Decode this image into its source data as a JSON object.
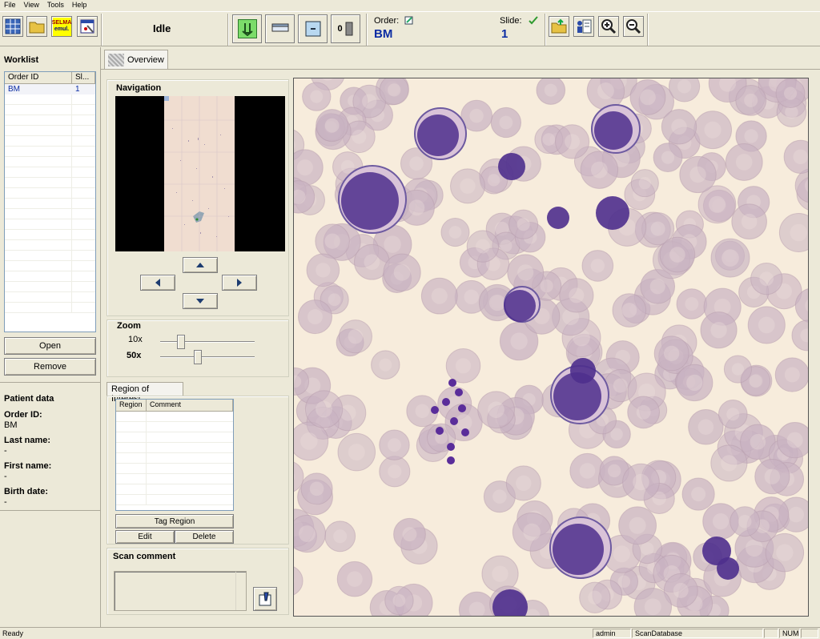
{
  "menu": [
    "File",
    "View",
    "Tools",
    "Help"
  ],
  "toolbar": {
    "status": "Idle",
    "order_label": "Order:",
    "order_value": "BM",
    "slide_label": "Slide:",
    "slide_value": "1",
    "selma_line1": "SELMA",
    "selma_line2": "emul.",
    "mode_label": "0"
  },
  "worklist": {
    "title": "Worklist",
    "columns": [
      "Order ID",
      "Sl..."
    ],
    "rows": [
      {
        "order_id": "BM",
        "slide": "1"
      }
    ],
    "open_label": "Open",
    "remove_label": "Remove"
  },
  "patient": {
    "title": "Patient data",
    "order_id_label": "Order ID:",
    "order_id": "BM",
    "last_name_label": "Last name:",
    "last_name": "-",
    "first_name_label": "First name:",
    "first_name": "-",
    "birth_date_label": "Birth date:",
    "birth_date": "-"
  },
  "tabs": {
    "overview": "Overview"
  },
  "navigation": {
    "title": "Navigation"
  },
  "zoom": {
    "title": "Zoom",
    "low_label": "10x",
    "high_label": "50x",
    "low_level": 0.22,
    "high_level": 0.4
  },
  "roi": {
    "tab": "Region of Interest",
    "columns": [
      "Region",
      "Comment"
    ],
    "tag_label": "Tag Region",
    "edit_label": "Edit",
    "delete_label": "Delete"
  },
  "scan_comment": {
    "title": "Scan comment"
  },
  "status": {
    "left": "Ready",
    "user": "admin",
    "db": "ScanDatabase",
    "num": "NUM"
  },
  "colors": {
    "accent_blue": "#0a2ca3",
    "check_green": "#2f9a2f",
    "cell_purple": "#4e2f8d",
    "rbc": "#c9b3c2",
    "background": "#f7ecdc"
  }
}
